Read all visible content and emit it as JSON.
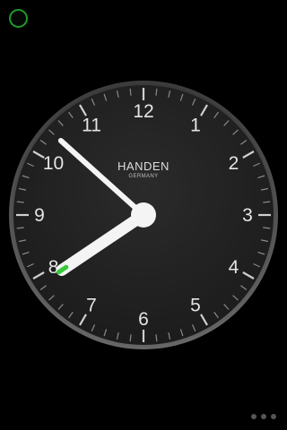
{
  "app": {
    "status_indicator_color": "#1f9b2a"
  },
  "clock": {
    "brand": "HANDEN",
    "brand_sub": "GERMANY",
    "numerals": [
      "12",
      "1",
      "2",
      "3",
      "4",
      "5",
      "6",
      "7",
      "8",
      "9",
      "10",
      "11"
    ],
    "time": {
      "hours": 7,
      "minutes": 52
    },
    "colors": {
      "face": "#242424",
      "rim": "#5a5a5a",
      "hands": "#f4f4f4",
      "hour_hand_tip": "#35c93a"
    }
  },
  "pager": {
    "page_count": 3,
    "icon": "more-dots-icon"
  }
}
